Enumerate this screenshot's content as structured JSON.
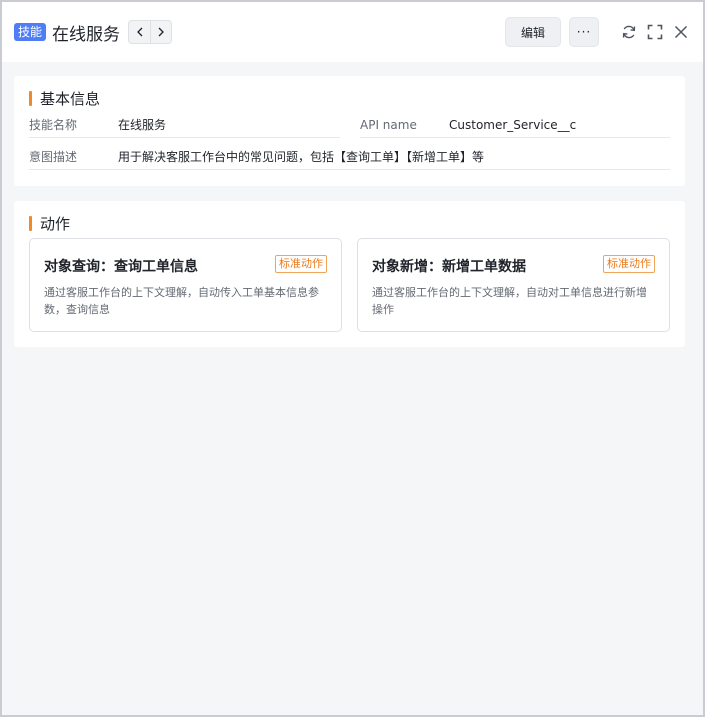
{
  "header": {
    "badge": "技能",
    "title": "在线服务",
    "edit_label": "编辑",
    "more_label": "···"
  },
  "basic": {
    "section_title": "基本信息",
    "fields": [
      {
        "label": "技能名称",
        "value": "在线服务"
      },
      {
        "label": "API name",
        "value": "Customer_Service__c"
      },
      {
        "label": "意图描述",
        "value": "用于解决客服工作台中的常见问题，包括【查询工单】【新增工单】等"
      }
    ]
  },
  "actions": {
    "section_title": "动作",
    "cards": [
      {
        "title": "对象查询：查询工单信息",
        "tag": "标准动作",
        "desc": "通过客服工作台的上下文理解，自动传入工单基本信息参数，查询信息"
      },
      {
        "title": "对象新增：新增工单数据",
        "tag": "标准动作",
        "desc": "通过客服工作台的上下文理解，自动对工单信息进行新增操作"
      }
    ]
  },
  "colors": {
    "badge": "#4f7df6",
    "accent_bar": "#ef8a2a",
    "tag_border": "#f1a55a",
    "tag_text": "#ea7c1d"
  },
  "icons": [
    "chevron-left-icon",
    "chevron-right-icon",
    "refresh-icon",
    "fullscreen-icon",
    "close-icon"
  ]
}
